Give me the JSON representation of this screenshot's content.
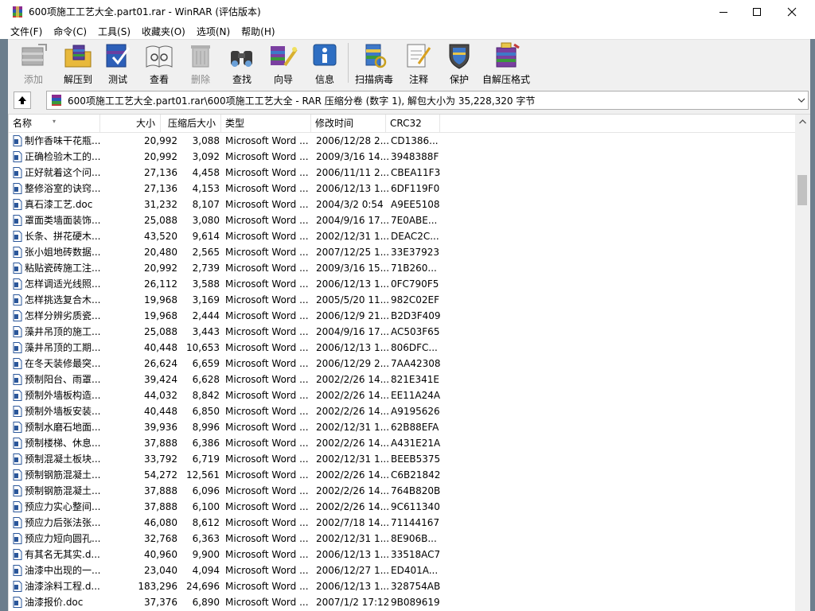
{
  "window": {
    "title": "600项施工工艺大全.part01.rar - WinRAR (评估版本)"
  },
  "menu": [
    "文件(F)",
    "命令(C)",
    "工具(S)",
    "收藏夹(O)",
    "选项(N)",
    "帮助(H)"
  ],
  "toolbar": [
    {
      "label": "添加",
      "icon": "add-icon",
      "enabled": false
    },
    {
      "label": "解压到",
      "icon": "extract-to-icon",
      "enabled": true
    },
    {
      "label": "测试",
      "icon": "test-icon",
      "enabled": true
    },
    {
      "label": "查看",
      "icon": "view-icon",
      "enabled": true
    },
    {
      "label": "删除",
      "icon": "delete-icon",
      "enabled": false
    },
    {
      "label": "查找",
      "icon": "find-icon",
      "enabled": true
    },
    {
      "label": "向导",
      "icon": "wizard-icon",
      "enabled": true
    },
    {
      "label": "信息",
      "icon": "info-icon",
      "enabled": true
    },
    {
      "label": "扫描病毒",
      "icon": "virus-scan-icon",
      "enabled": true
    },
    {
      "label": "注释",
      "icon": "comment-icon",
      "enabled": true
    },
    {
      "label": "保护",
      "icon": "protect-icon",
      "enabled": true
    },
    {
      "label": "自解压格式",
      "icon": "sfx-icon",
      "enabled": true
    }
  ],
  "address": {
    "path": "600项施工工艺大全.part01.rar\\600项施工工艺大全 - RAR 压缩分卷 (数字 1), 解包大小为 35,228,320 字节"
  },
  "columns": {
    "name": "名称",
    "size": "大小",
    "packed": "压缩后大小",
    "type": "类型",
    "modified": "修改时间",
    "crc": "CRC32"
  },
  "files": [
    {
      "name": "制作香味干花瓶...",
      "size": "20,992",
      "packed": "3,088",
      "type": "Microsoft Word ...",
      "modified": "2006/12/28 2...",
      "crc": "CD1386..."
    },
    {
      "name": "正确检验木工的...",
      "size": "20,992",
      "packed": "3,092",
      "type": "Microsoft Word ...",
      "modified": "2009/3/16 14...",
      "crc": "3948388F"
    },
    {
      "name": "正好就着这个问...",
      "size": "27,136",
      "packed": "4,458",
      "type": "Microsoft Word ...",
      "modified": "2006/11/11 2...",
      "crc": "CBEA11F3"
    },
    {
      "name": "整修浴室的诀窍...",
      "size": "27,136",
      "packed": "4,153",
      "type": "Microsoft Word ...",
      "modified": "2006/12/13 1...",
      "crc": "6DF119F0"
    },
    {
      "name": "真石漆工艺.doc",
      "size": "31,232",
      "packed": "8,107",
      "type": "Microsoft Word ...",
      "modified": "2004/3/2 0:54",
      "crc": "A9EE5108"
    },
    {
      "name": "罩面类墙面装饰...",
      "size": "25,088",
      "packed": "3,080",
      "type": "Microsoft Word ...",
      "modified": "2004/9/16 17...",
      "crc": "7E0ABE..."
    },
    {
      "name": "长条、拼花硬木...",
      "size": "43,520",
      "packed": "9,614",
      "type": "Microsoft Word ...",
      "modified": "2002/12/31 1...",
      "crc": "DEAC2C..."
    },
    {
      "name": "张小姐地砖数据...",
      "size": "20,480",
      "packed": "2,565",
      "type": "Microsoft Word ...",
      "modified": "2007/12/25 1...",
      "crc": "33E37923"
    },
    {
      "name": "粘贴瓷砖施工注...",
      "size": "20,992",
      "packed": "2,739",
      "type": "Microsoft Word ...",
      "modified": "2009/3/16 15...",
      "crc": "71B260..."
    },
    {
      "name": "怎样调适光线照...",
      "size": "26,112",
      "packed": "3,588",
      "type": "Microsoft Word ...",
      "modified": "2006/12/13 1...",
      "crc": "0FC790F5"
    },
    {
      "name": "怎样挑选复合木...",
      "size": "19,968",
      "packed": "3,169",
      "type": "Microsoft Word ...",
      "modified": "2005/5/20 11...",
      "crc": "982C02EF"
    },
    {
      "name": "怎样分辨劣质瓷...",
      "size": "19,968",
      "packed": "2,444",
      "type": "Microsoft Word ...",
      "modified": "2006/12/9 21...",
      "crc": "B2D3F409"
    },
    {
      "name": "藻井吊顶的施工...",
      "size": "25,088",
      "packed": "3,443",
      "type": "Microsoft Word ...",
      "modified": "2004/9/16 17...",
      "crc": "AC503F65"
    },
    {
      "name": "藻井吊顶的工期...",
      "size": "40,448",
      "packed": "10,653",
      "type": "Microsoft Word ...",
      "modified": "2006/12/13 1...",
      "crc": "806DFC..."
    },
    {
      "name": "在冬天装修最突...",
      "size": "26,624",
      "packed": "6,659",
      "type": "Microsoft Word ...",
      "modified": "2006/12/29 2...",
      "crc": "7AA42308"
    },
    {
      "name": "预制阳台、雨罩...",
      "size": "39,424",
      "packed": "6,628",
      "type": "Microsoft Word ...",
      "modified": "2002/2/26 14...",
      "crc": "821E341E"
    },
    {
      "name": "预制外墙板构造...",
      "size": "44,032",
      "packed": "8,842",
      "type": "Microsoft Word ...",
      "modified": "2002/2/26 14...",
      "crc": "EE11A24A"
    },
    {
      "name": "预制外墙板安装...",
      "size": "40,448",
      "packed": "6,850",
      "type": "Microsoft Word ...",
      "modified": "2002/2/26 14...",
      "crc": "A9195626"
    },
    {
      "name": "预制水磨石地面...",
      "size": "39,936",
      "packed": "8,996",
      "type": "Microsoft Word ...",
      "modified": "2002/12/31 1...",
      "crc": "62B88EFA"
    },
    {
      "name": "预制楼梯、休息...",
      "size": "37,888",
      "packed": "6,386",
      "type": "Microsoft Word ...",
      "modified": "2002/2/26 14...",
      "crc": "A431E21A"
    },
    {
      "name": "预制混凝土板块...",
      "size": "33,792",
      "packed": "6,719",
      "type": "Microsoft Word ...",
      "modified": "2002/12/31 1...",
      "crc": "BEEB5375"
    },
    {
      "name": "预制钢筋混凝土...",
      "size": "54,272",
      "packed": "12,561",
      "type": "Microsoft Word ...",
      "modified": "2002/2/26 14...",
      "crc": "C6B21842"
    },
    {
      "name": "预制钢筋混凝土...",
      "size": "37,888",
      "packed": "6,096",
      "type": "Microsoft Word ...",
      "modified": "2002/2/26 14...",
      "crc": "764B820B"
    },
    {
      "name": "预应力实心整间...",
      "size": "37,888",
      "packed": "6,100",
      "type": "Microsoft Word ...",
      "modified": "2002/2/26 14...",
      "crc": "9C611340"
    },
    {
      "name": "预应力后张法张...",
      "size": "46,080",
      "packed": "8,612",
      "type": "Microsoft Word ...",
      "modified": "2002/7/18 14...",
      "crc": "71144167"
    },
    {
      "name": "预应力短向圆孔...",
      "size": "32,768",
      "packed": "6,363",
      "type": "Microsoft Word ...",
      "modified": "2002/12/31 1...",
      "crc": "8E906B..."
    },
    {
      "name": "有其名无其实.d...",
      "size": "40,960",
      "packed": "9,900",
      "type": "Microsoft Word ...",
      "modified": "2006/12/13 1...",
      "crc": "33518AC7"
    },
    {
      "name": "油漆中出现的一...",
      "size": "23,040",
      "packed": "4,094",
      "type": "Microsoft Word ...",
      "modified": "2006/12/27 1...",
      "crc": "ED401A..."
    },
    {
      "name": "油漆涂料工程.d...",
      "size": "183,296",
      "packed": "24,696",
      "type": "Microsoft Word ...",
      "modified": "2006/12/13 1...",
      "crc": "328754AB"
    },
    {
      "name": "油漆报价.doc",
      "size": "37,376",
      "packed": "6,890",
      "type": "Microsoft Word ...",
      "modified": "2007/1/2 17:12",
      "crc": "9B089619"
    }
  ]
}
